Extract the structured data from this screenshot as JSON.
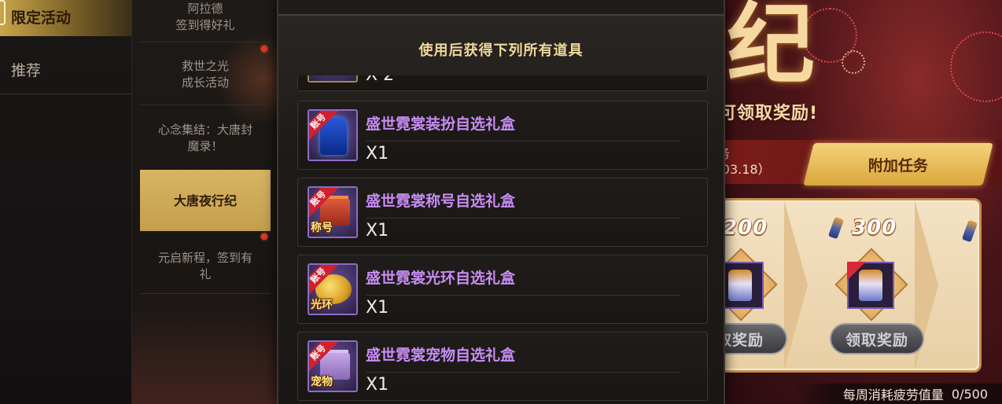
{
  "categories": [
    {
      "label": "限定活动",
      "active": true
    },
    {
      "label": "推荐",
      "active": false
    }
  ],
  "activities": [
    {
      "line1": "阿拉德",
      "line2": "签到得好礼"
    },
    {
      "line1": "救世之光",
      "line2": "成长活动"
    },
    {
      "line1": "心念集结：大唐封",
      "line2": "魔录！"
    },
    {
      "line1": "大唐夜行纪",
      "line2": ""
    },
    {
      "line1": "元启新程，签到有",
      "line2": "礼"
    }
  ],
  "popup": {
    "title": "使用后获得下列所有道具",
    "partial_qty": "X 2",
    "items": [
      {
        "name": "盛世霓裳装扮自选礼盒",
        "qty": "X1",
        "corner": "账号",
        "badge": ""
      },
      {
        "name": "盛世霓裳称号自选礼盒",
        "qty": "X1",
        "corner": "账号",
        "badge": "称号"
      },
      {
        "name": "盛世霓裳光环自选礼盒",
        "qty": "X1",
        "corner": "账号",
        "badge": "光环"
      },
      {
        "name": "盛世霓裳宠物自选礼盒",
        "qty": "X1",
        "corner": "账号",
        "badge": "宠物"
      }
    ]
  },
  "event": {
    "big_char": "纪",
    "reward_hint": "可领取奖励!",
    "task_tab_left_line1": "务",
    "task_tab_left_line2": "-03.18）",
    "task_tab_extra": "附加任务",
    "milestones": [
      "200",
      "300"
    ],
    "claim_label": "领取奖励",
    "claim_label_partial": "取奖励",
    "fatigue_label": "每周消耗疲劳值量",
    "fatigue_value": "0/500"
  },
  "colors": {
    "accent_gold": "#d8b463",
    "item_purple": "#c88cf4",
    "title_gold": "#f0d89a",
    "red_dot": "#e03a22"
  }
}
